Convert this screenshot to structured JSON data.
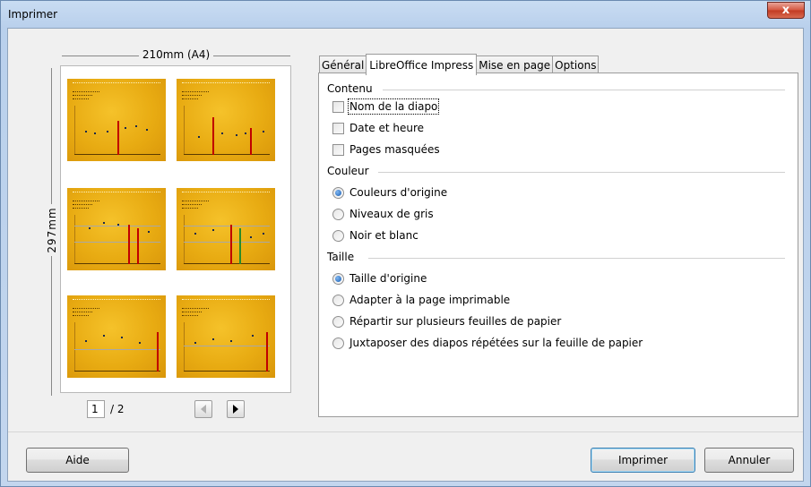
{
  "window": {
    "title": "Imprimer",
    "close_symbol": "x"
  },
  "preview": {
    "width_label": "210mm (A4)",
    "height_label": "297mm",
    "page_current": "1",
    "page_total": "/ 2"
  },
  "tabs": [
    "Général",
    "LibreOffice Impress",
    "Mise en page",
    "Options"
  ],
  "active_tab": "LibreOffice Impress",
  "contenu": {
    "heading": "Contenu",
    "options": [
      {
        "label": "Nom de la diapo",
        "checked": false
      },
      {
        "label": "Date et heure",
        "checked": false
      },
      {
        "label": "Pages masquées",
        "checked": false
      }
    ]
  },
  "couleur": {
    "heading": "Couleur",
    "options": [
      {
        "label": "Couleurs d'origine",
        "selected": true
      },
      {
        "label": "Niveaux de gris",
        "selected": false
      },
      {
        "label": "Noir et blanc",
        "selected": false
      }
    ]
  },
  "taille": {
    "heading": "Taille",
    "options": [
      {
        "label": "Taille d'origine",
        "selected": true
      },
      {
        "label": "Adapter à la page imprimable",
        "selected": false
      },
      {
        "label": "Répartir sur plusieurs feuilles de papier",
        "selected": false
      },
      {
        "label": "Juxtaposer des diapos répétées sur la feuille de papier",
        "selected": false
      }
    ]
  },
  "buttons": {
    "help": "Aide",
    "print": "Imprimer",
    "cancel": "Annuler"
  },
  "colors": {
    "slide_bg": "#e8ab12",
    "accent_red": "#c00000",
    "close_red": "#c23a22"
  }
}
